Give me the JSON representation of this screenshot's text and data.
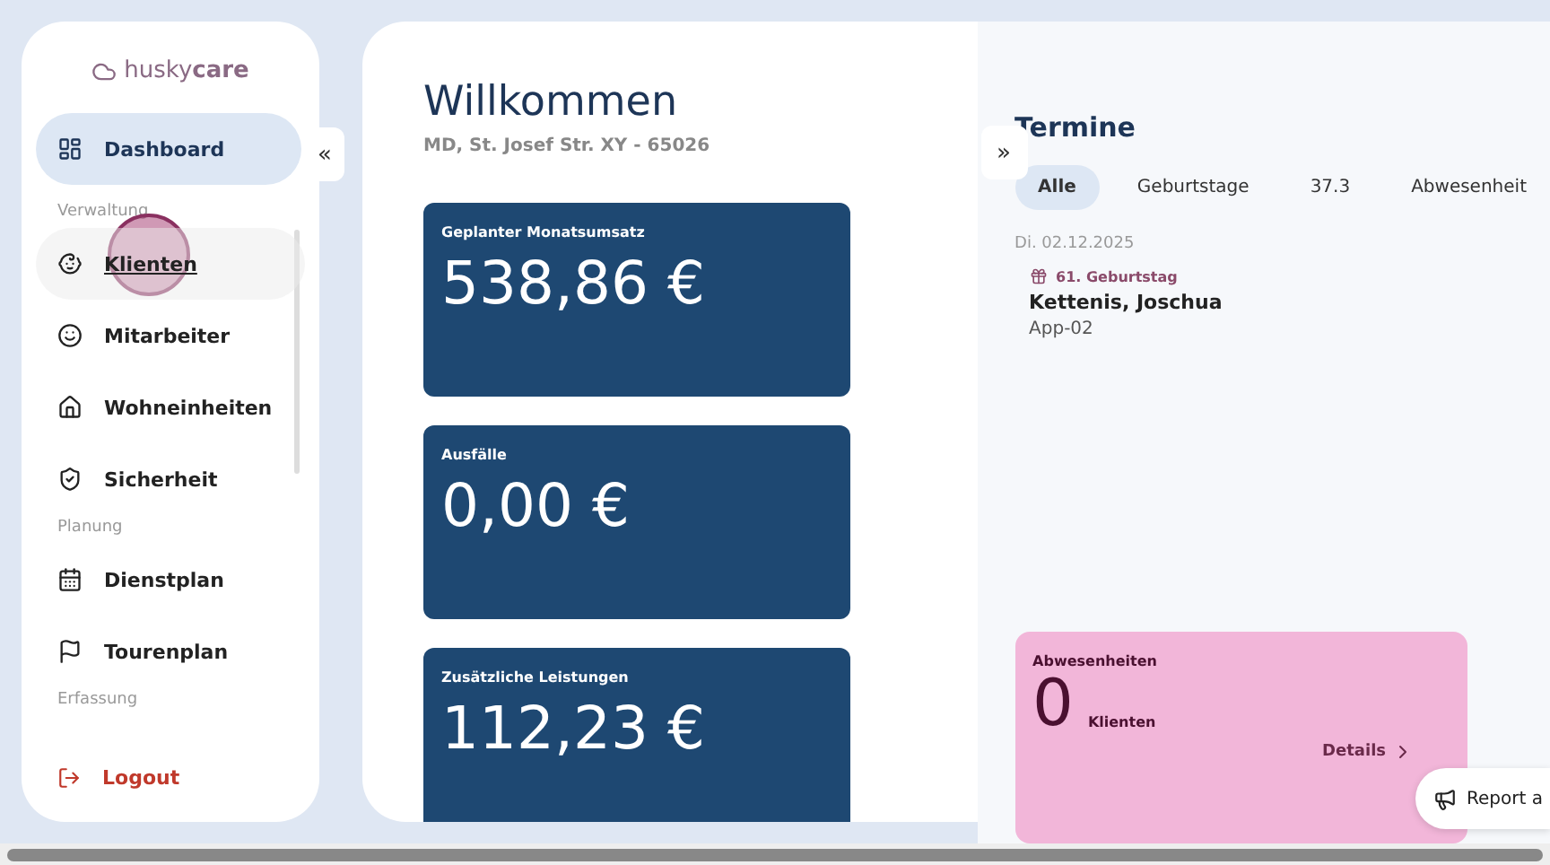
{
  "sidebar": {
    "logo": {
      "part_1": "husky",
      "part_2": "care"
    },
    "collapse_button": "«",
    "sections": [
      {
        "items": [
          {
            "label": "Dashboard",
            "selected": true,
            "hovered": false
          }
        ]
      },
      {
        "title": "Verwaltung",
        "items": [
          {
            "label": "Klienten",
            "selected": false,
            "hovered": true
          },
          {
            "label": "Mitarbeiter",
            "selected": false,
            "hovered": false
          },
          {
            "label": "Wohneinheiten",
            "selected": false,
            "hovered": false
          },
          {
            "label": "Sicherheit",
            "selected": false,
            "hovered": false
          }
        ]
      },
      {
        "title": "Planung",
        "items": [
          {
            "label": "Dienstplan",
            "selected": false,
            "hovered": false
          },
          {
            "label": "Tourenplan",
            "selected": false,
            "hovered": false
          }
        ]
      },
      {
        "title": "Erfassung"
      }
    ],
    "logout": "Logout"
  },
  "main": {
    "title": "Willkommen",
    "subtitle": "MD, St. Josef Str. XY - 65026",
    "cards": [
      {
        "label": "Geplanter Monatsumsatz",
        "value": "538,86 €"
      },
      {
        "label": "Ausfälle",
        "value": "0,00 €"
      },
      {
        "label": "Zusätzliche Leistungen",
        "value": "112,23 €"
      }
    ]
  },
  "appointments": {
    "expand_button": "»",
    "title": "Termine",
    "tabs": [
      {
        "label": "Alle",
        "selected": true
      },
      {
        "label": "Geburtstage",
        "selected": false
      },
      {
        "label": "37.3",
        "selected": false
      },
      {
        "label": "Abwesenheit",
        "selected": false
      }
    ],
    "days": [
      {
        "date": "Di. 02.12.2025",
        "entries": [
          {
            "tag": "61. Geburtstag",
            "name": "Kettenis, Joschua",
            "unit": "App-02"
          }
        ]
      }
    ],
    "absence_card": {
      "title": "Abwesenheiten",
      "count": "0",
      "unit": "Klienten",
      "link": "Details"
    }
  },
  "report_button": "Report a"
}
